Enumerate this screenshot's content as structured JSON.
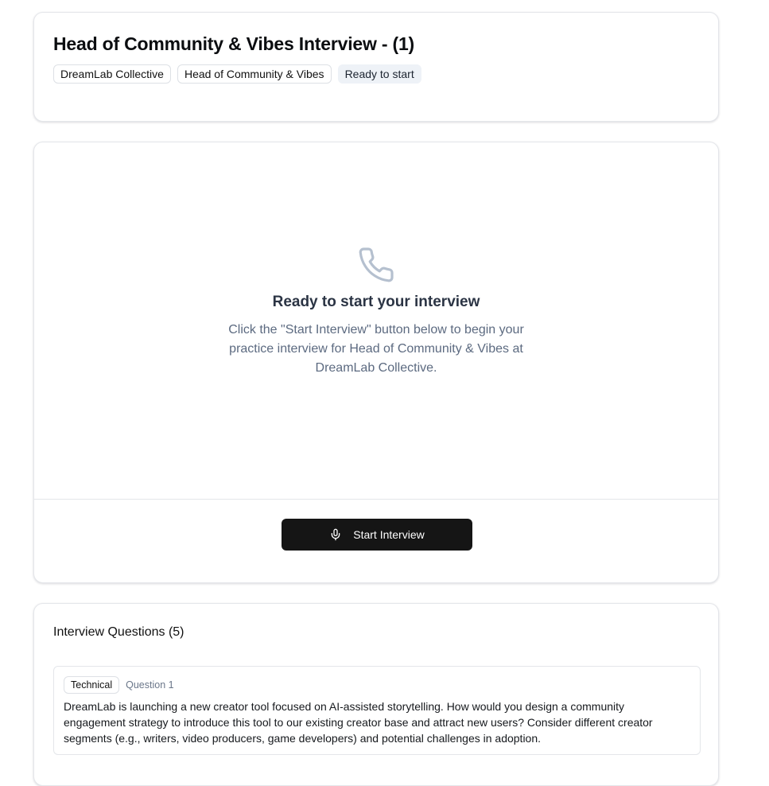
{
  "header": {
    "title": "Head of Community & Vibes Interview - (1)",
    "badges": [
      "DreamLab Collective",
      "Head of Community & Vibes"
    ],
    "status": "Ready to start"
  },
  "interview": {
    "icon": "phone-icon",
    "title": "Ready to start your interview",
    "description": "Click the \"Start Interview\" button below to begin your practice interview for Head of Community & Vibes at DreamLab Collective.",
    "start_button": "Start Interview",
    "start_button_icon": "mic-icon"
  },
  "questions": {
    "heading": "Interview Questions (5)",
    "items": [
      {
        "type": "Technical",
        "number": "Question 1",
        "text": "DreamLab is launching a new creator tool focused on AI-assisted storytelling. How would you design a community engagement strategy to introduce this tool to our existing creator base and attract new users? Consider different creator segments (e.g., writers, video producers, game developers) and potential challenges in adoption."
      }
    ]
  },
  "colors": {
    "primary_button": "#151515",
    "status_badge_bg": "#eef2f7",
    "muted_text": "#5c6a80",
    "icon_stroke": "#b5c0cf"
  }
}
